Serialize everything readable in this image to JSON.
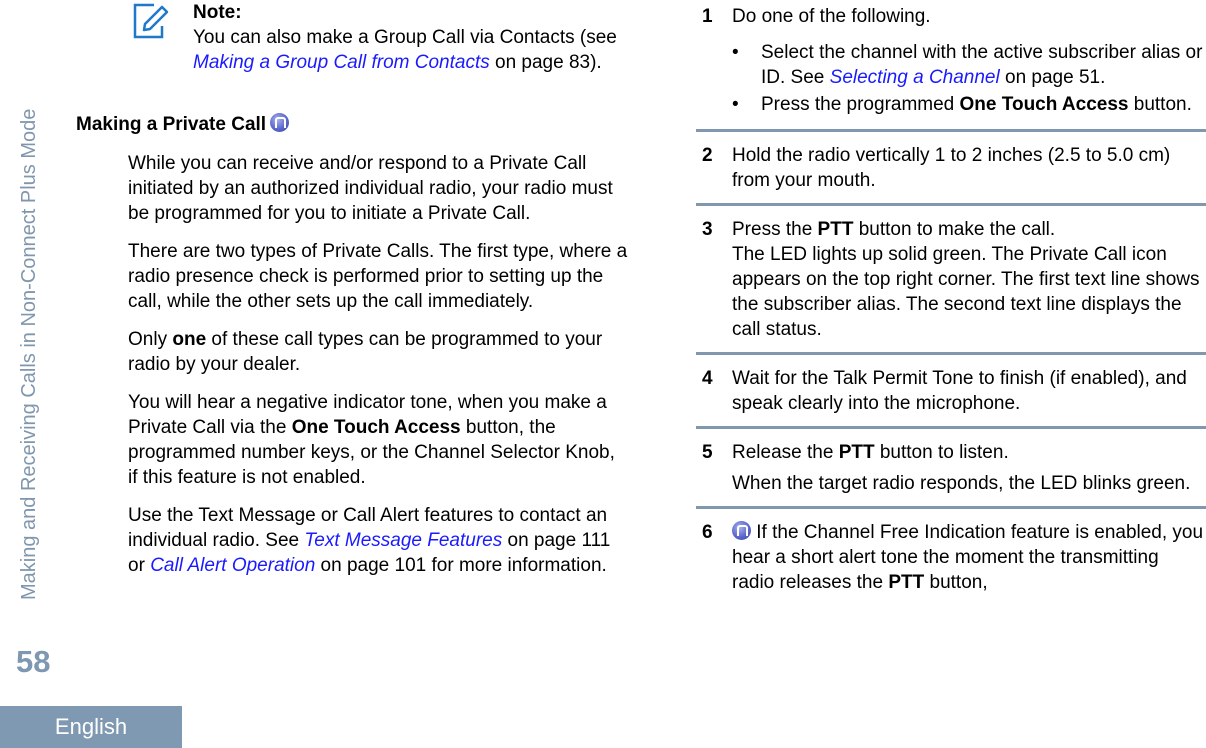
{
  "sidebar": {
    "chapter_title": "Making and Receiving Calls in Non-Connect Plus Mode",
    "page_number": "58",
    "language": "English"
  },
  "note": {
    "label": "Note:",
    "text_before": "You can also make a Group Call via Contacts (see ",
    "link": "Making a Group Call from Contacts",
    "text_after": " on page 83)."
  },
  "section": {
    "heading": "Making a Private Call",
    "heading_icon": "radio-feature-icon",
    "paragraphs": {
      "p1": "While you can receive and/or respond to a Private Call initiated by an authorized individual radio, your radio must be programmed for you to initiate a Private Call.",
      "p2": "There are two types of Private Calls. The first type, where a radio presence check is performed prior to setting up the call, while the other sets up the call immediately.",
      "p3_a": "Only ",
      "p3_bold": "one",
      "p3_b": " of these call types can be programmed to your radio by your dealer.",
      "p4_a": "You will hear a negative indicator tone, when you make a Private Call via the ",
      "p4_bold": "One Touch Access",
      "p4_b": " button, the programmed number keys, or the Channel Selector Knob, if this feature is not enabled.",
      "p5_a": "Use the Text Message or Call Alert features to contact an individual radio. See ",
      "p5_link1": "Text Message Features",
      "p5_b": " on page 111 or ",
      "p5_link2": "Call Alert Operation",
      "p5_c": " on page 101 for more information."
    }
  },
  "steps": [
    {
      "num": "1",
      "text": "Do one of the following.",
      "bullets": {
        "b1_a": "Select the channel with the active subscriber alias or ID. See ",
        "b1_link": "Selecting a Channel",
        "b1_b": " on page 51.",
        "b2_a": "Press the programmed ",
        "b2_bold": "One Touch Access",
        "b2_b": " button."
      }
    },
    {
      "num": "2",
      "text": "Hold the radio vertically 1 to 2 inches (2.5 to 5.0 cm) from your mouth."
    },
    {
      "num": "3",
      "text_a": "Press the ",
      "text_bold": "PTT",
      "text_b": " button to make the call.",
      "detail": "The LED lights up solid green. The Private Call icon appears on the top right corner. The first text line shows the subscriber alias. The second text line displays the call status."
    },
    {
      "num": "4",
      "text": "Wait for the Talk Permit Tone to finish (if enabled), and speak clearly into the microphone."
    },
    {
      "num": "5",
      "text_a": "Release the ",
      "text_bold": "PTT",
      "text_b": " button to listen.",
      "detail": "When the target radio responds, the LED blinks green."
    },
    {
      "num": "6",
      "text_a": " If the Channel Free Indication feature is enabled, you hear a short alert tone the moment the transmitting radio releases the ",
      "text_bold": "PTT",
      "text_b": " button,"
    }
  ],
  "colors": {
    "accent_blue_gray": "#8097ae",
    "link_blue": "#1a1aff",
    "note_icon_blue": "#1f78c8"
  }
}
